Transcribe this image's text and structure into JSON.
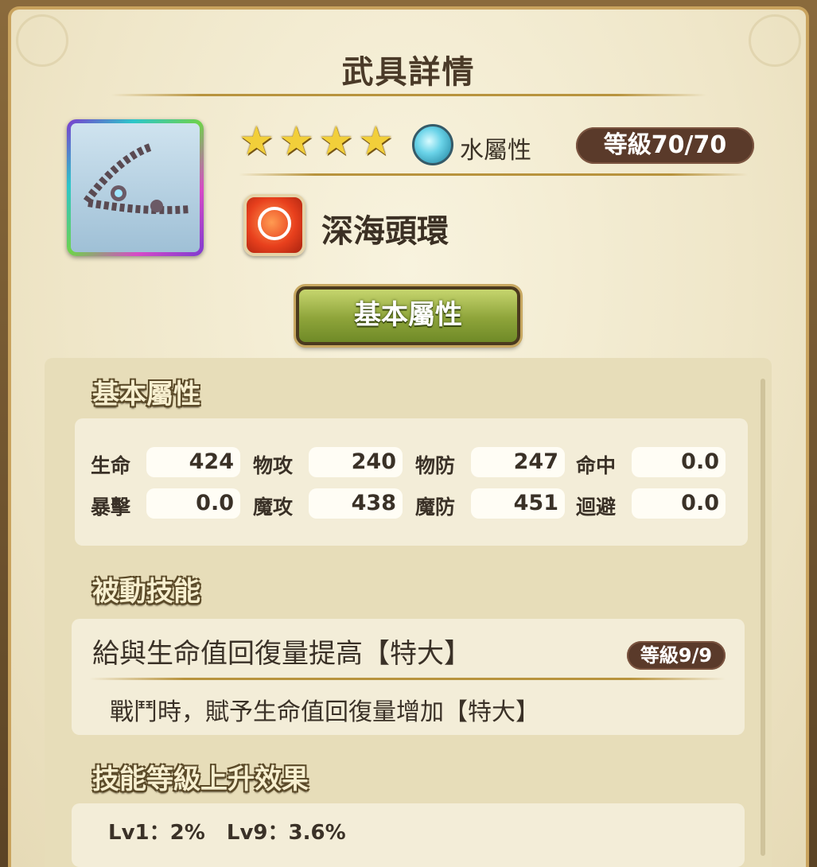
{
  "header": {
    "title": "武具詳情"
  },
  "item": {
    "icon": "bracelet-equipment-icon",
    "stars": 4,
    "star_glyph": "★",
    "element_icon": "water-element-icon",
    "element_label": "水屬性",
    "level_label": "等級70/70",
    "type_icon": "accessory-type-icon",
    "name": "深海頭環"
  },
  "tabs": {
    "active_label": "基本屬性"
  },
  "basic": {
    "section_title": "基本屬性",
    "stats": [
      {
        "label": "生命",
        "value": "424"
      },
      {
        "label": "物攻",
        "value": "240"
      },
      {
        "label": "物防",
        "value": "247"
      },
      {
        "label": "命中",
        "value": "0.0"
      },
      {
        "label": "暴擊",
        "value": "0.0"
      },
      {
        "label": "魔攻",
        "value": "438"
      },
      {
        "label": "魔防",
        "value": "451"
      },
      {
        "label": "迴避",
        "value": "0.0"
      }
    ]
  },
  "passive": {
    "section_title": "被動技能",
    "skill_name": "給與生命值回復量提高【特大】",
    "skill_level": "等級9/9",
    "skill_desc": "戰鬥時，賦予生命值回復量增加【特大】"
  },
  "levelup": {
    "section_title": "技能等級上升效果",
    "text": "Lv1：2%   Lv9：3.6%"
  },
  "colors": {
    "frame_gold": "#c9a35e",
    "pill_brown": "#5a3a2a",
    "button_green": "#8ea43a",
    "parchment": "#efe6c8"
  }
}
